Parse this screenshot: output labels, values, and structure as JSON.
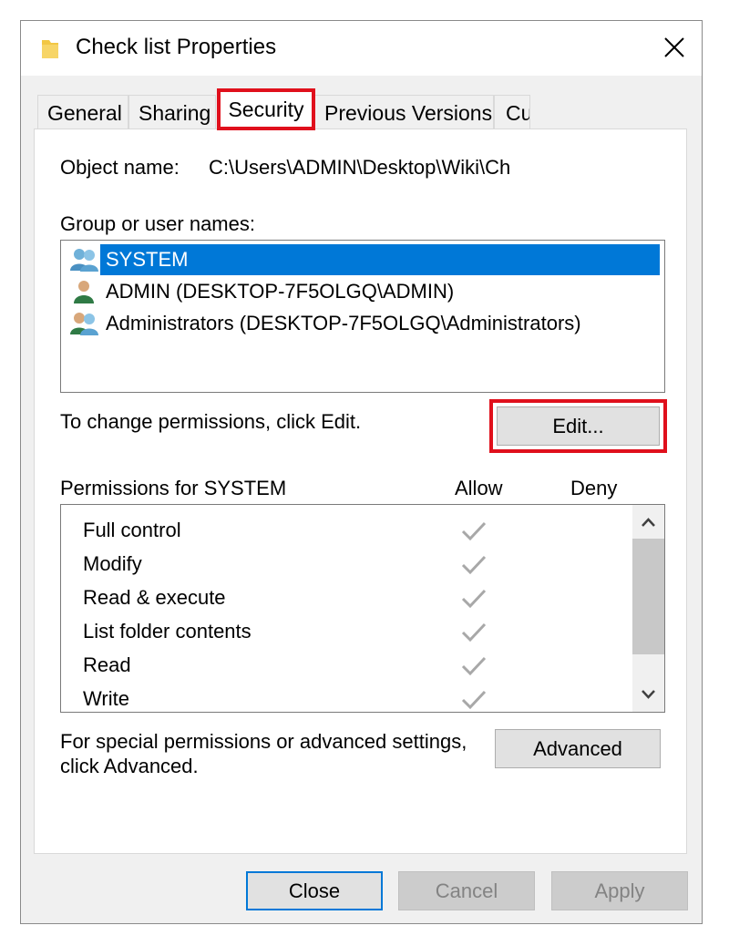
{
  "window": {
    "title": "Check list Properties",
    "close_symbol": "✕"
  },
  "tabs": [
    {
      "label": "General"
    },
    {
      "label": "Sharing"
    },
    {
      "label": "Security",
      "selected": true,
      "highlighted": true
    },
    {
      "label": "Previous Versions"
    },
    {
      "label": "Cu"
    }
  ],
  "object": {
    "label": "Object name:",
    "value": "C:\\Users\\ADMIN\\Desktop\\Wiki\\Ch"
  },
  "groups": {
    "label": "Group or user names:",
    "items": [
      {
        "name": "SYSTEM",
        "icon": "users-group-icon",
        "selected": true
      },
      {
        "name": "ADMIN (DESKTOP-7F5OLGQ\\ADMIN)",
        "icon": "user-icon",
        "selected": false
      },
      {
        "name": "Administrators (DESKTOP-7F5OLGQ\\Administrators)",
        "icon": "users-group-icon",
        "selected": false
      }
    ]
  },
  "change": {
    "text": "To change permissions, click Edit.",
    "edit_label": "Edit..."
  },
  "permissions": {
    "header": "Permissions for SYSTEM",
    "allow_header": "Allow",
    "deny_header": "Deny",
    "rows": [
      {
        "name": "Full control",
        "allow": true,
        "deny": false
      },
      {
        "name": "Modify",
        "allow": true,
        "deny": false
      },
      {
        "name": "Read & execute",
        "allow": true,
        "deny": false
      },
      {
        "name": "List folder contents",
        "allow": true,
        "deny": false
      },
      {
        "name": "Read",
        "allow": true,
        "deny": false
      },
      {
        "name": "Write",
        "allow": true,
        "deny": false
      }
    ]
  },
  "advanced": {
    "line1": "For special permissions or advanced settings,",
    "line2": "click Advanced.",
    "button_label": "Advanced"
  },
  "footer": {
    "close_label": "Close",
    "cancel_label": "Cancel",
    "apply_label": "Apply"
  },
  "colors": {
    "highlight": "#e0101c",
    "selection": "#0078d7",
    "accent": "#0078d7",
    "check": "#a8a8a8"
  }
}
